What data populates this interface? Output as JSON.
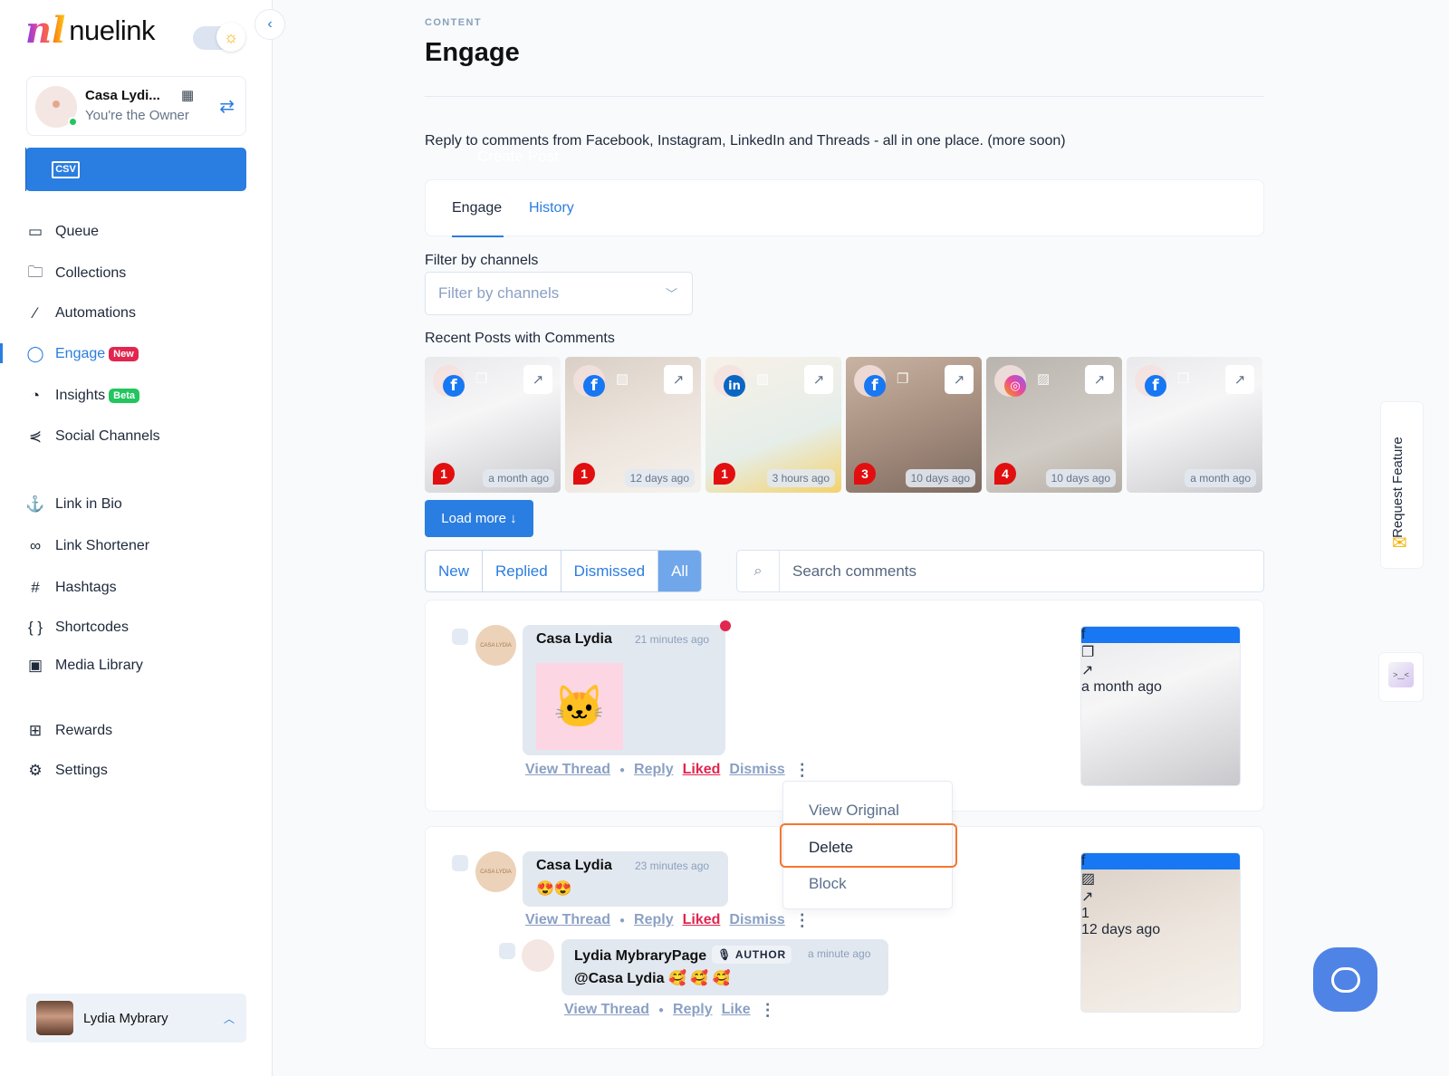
{
  "brand": {
    "name": "nuelink",
    "mark": "nl"
  },
  "theme_toggle": {
    "icon": "sun-icon",
    "mode": "light"
  },
  "account": {
    "name": "Casa Lydi...",
    "role": "You're the Owner",
    "status": "online"
  },
  "create_post": {
    "label": "Create Post",
    "csv_label": "CSV"
  },
  "nav": [
    {
      "label": "Queue",
      "icon": "calendar-icon",
      "glyph": "▭"
    },
    {
      "label": "Collections",
      "icon": "folder-icon",
      "glyph": "🗀"
    },
    {
      "label": "Automations",
      "icon": "magic-wand-icon",
      "glyph": "⁄"
    },
    {
      "label": "Engage",
      "icon": "chat-bubble-icon",
      "glyph": "◯",
      "badge": "New",
      "active": true
    },
    {
      "label": "Insights",
      "icon": "pie-chart-icon",
      "glyph": "◔",
      "badge": "Beta"
    },
    {
      "label": "Social Channels",
      "icon": "share-icon",
      "glyph": "⋞"
    },
    {
      "label": "Link in Bio",
      "icon": "anchor-icon",
      "glyph": "⚓"
    },
    {
      "label": "Link Shortener",
      "icon": "link-icon",
      "glyph": "∞"
    },
    {
      "label": "Hashtags",
      "icon": "hashtag-icon",
      "glyph": "#"
    },
    {
      "label": "Shortcodes",
      "icon": "braces-icon",
      "glyph": "{ }"
    },
    {
      "label": "Media Library",
      "icon": "photo-library-icon",
      "glyph": "▣"
    },
    {
      "label": "Rewards",
      "icon": "gift-icon",
      "glyph": "⊞"
    },
    {
      "label": "Settings",
      "icon": "gear-icon",
      "glyph": "⚙"
    }
  ],
  "user": {
    "name": "Lydia Mybrary"
  },
  "page": {
    "breadcrumb": "CONTENT",
    "title": "Engage",
    "description": "Reply to comments from Facebook, Instagram, LinkedIn and Threads - all in one place. (more soon)"
  },
  "tabs": [
    {
      "label": "Engage",
      "active": true
    },
    {
      "label": "History",
      "active": false
    }
  ],
  "filter": {
    "label": "Filter by channels",
    "placeholder": "Filter by channels"
  },
  "recent_posts": {
    "label": "Recent Posts with Comments",
    "items": [
      {
        "channel": "facebook",
        "glyph": "f",
        "comments": "1",
        "age": "a month ago",
        "bg": "linear-gradient(160deg,#e9e9ec 0%,#f6f6f7 40%,#c9c9cd 100%)",
        "media": "carousel"
      },
      {
        "channel": "facebook",
        "glyph": "f",
        "comments": "1",
        "age": "12 days ago",
        "bg": "linear-gradient(160deg,#d9cfc6 0%,#ece4dc 50%,#f5f1ec 100%)",
        "media": "image"
      },
      {
        "channel": "linkedin",
        "glyph": "in",
        "comments": "1",
        "age": "3 hours ago",
        "bg": "linear-gradient(160deg,#f7f1e8 0%,#e6eee9 60%,#f3d26b 100%)",
        "media": "image"
      },
      {
        "channel": "facebook",
        "glyph": "f",
        "comments": "3",
        "age": "10 days ago",
        "bg": "linear-gradient(160deg,#c9b3a3 0%,#a78f80 50%,#7d6a60 100%)",
        "media": "carousel"
      },
      {
        "channel": "instagram",
        "glyph": "◎",
        "comments": "4",
        "age": "10 days ago",
        "bg": "linear-gradient(160deg,#b9b4ad 0%,#d1ccc5 60%,#b5aea6 100%)",
        "media": "image"
      },
      {
        "channel": "facebook",
        "glyph": "f",
        "comments": "",
        "age": "a month ago",
        "bg": "linear-gradient(160deg,#e9e9ec 0%,#f6f6f7 40%,#c9c9cd 100%)",
        "media": "carousel"
      }
    ]
  },
  "load_more": {
    "label": "Load more ↓"
  },
  "status_filter": [
    {
      "label": "New",
      "active": false
    },
    {
      "label": "Replied",
      "active": false
    },
    {
      "label": "Dismissed",
      "active": false
    },
    {
      "label": "All",
      "active": true
    }
  ],
  "search": {
    "placeholder": "Search comments",
    "value": ""
  },
  "comments": [
    {
      "author": "Casa Lydia",
      "time": "21 minutes ago",
      "content": "sticker",
      "sticker_glyph": "🐱",
      "unread": true,
      "actions": {
        "view_thread": "View Thread",
        "reply": "Reply",
        "like": "Liked",
        "dismiss": "Dismiss"
      },
      "post": {
        "channel": "facebook",
        "age": "a month ago",
        "comments": ""
      }
    },
    {
      "author": "Casa Lydia",
      "time": "23 minutes ago",
      "text": "😍😍",
      "unread": false,
      "actions": {
        "view_thread": "View Thread",
        "reply": "Reply",
        "like": "Liked",
        "dismiss": "Dismiss"
      },
      "post": {
        "channel": "facebook",
        "age": "12 days ago",
        "comments": "1"
      },
      "reply": {
        "author": "Lydia MybraryPage",
        "badge": "AUTHOR",
        "time": "a minute ago",
        "text": "@Casa Lydia 🥰 🥰 🥰",
        "actions": {
          "view_thread": "View Thread",
          "reply": "Reply",
          "like": "Like"
        }
      }
    }
  ],
  "context_menu": {
    "items": [
      "View Original",
      "Delete",
      "Block"
    ],
    "highlighted": "Delete"
  },
  "request_feature": {
    "label": "Request Feature"
  },
  "colors": {
    "accent": "#2a7de1",
    "new_badge": "#e1264f",
    "beta_badge": "#22c55e",
    "liked": "#e1264f",
    "highlight_outline": "#f4772e"
  }
}
